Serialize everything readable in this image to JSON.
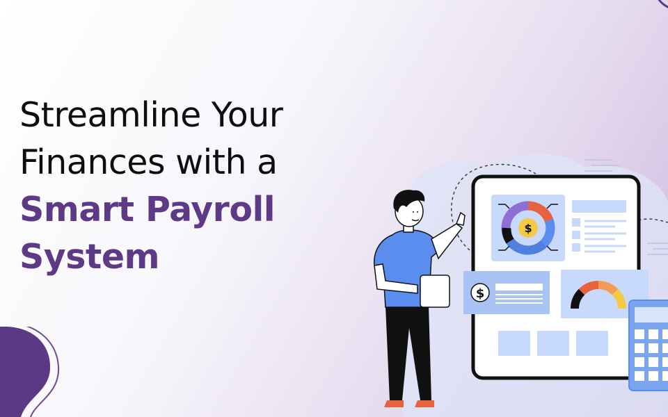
{
  "headline": {
    "line1": "Streamline Your",
    "line2": "Finances with a",
    "line3": "Smart Payroll",
    "line4": "System"
  },
  "colors": {
    "text": "#0e0e10",
    "accent": "#5e3a86",
    "shirt": "#5b8def",
    "card": "#c7dafb",
    "panel": "#a9c3f5",
    "gauge_red": "#e8623e",
    "gauge_orange": "#f39c53",
    "gauge_yellow": "#f6c945"
  },
  "illustration": {
    "dollar_symbol": "$",
    "dollar_symbol_card": "$"
  }
}
